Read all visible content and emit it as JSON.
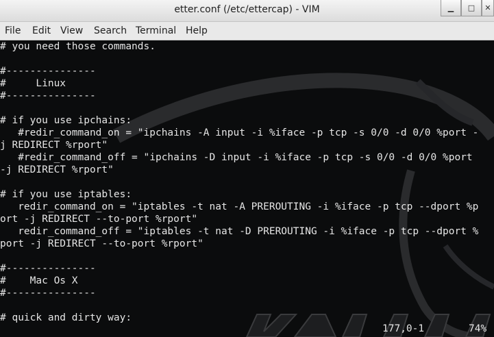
{
  "window": {
    "title": "etter.conf (/etc/ettercap) - VIM",
    "controls": [
      {
        "name": "minimize",
        "symbol": "▁"
      },
      {
        "name": "maximize",
        "symbol": "□"
      },
      {
        "name": "close",
        "symbol": "✕"
      }
    ]
  },
  "menu": [
    "File",
    "Edit",
    "View",
    "Search",
    "Terminal",
    "Help"
  ],
  "editor": {
    "lines": [
      "# you need those commands.",
      "",
      "#---------------",
      "#     Linux",
      "#---------------",
      "",
      "# if you use ipchains:",
      "   #redir_command_on = \"ipchains -A input -i %iface -p tcp -s 0/0 -d 0/0 %port -",
      "j REDIRECT %rport\"",
      "   #redir_command_off = \"ipchains -D input -i %iface -p tcp -s 0/0 -d 0/0 %port",
      "-j REDIRECT %rport\"",
      "",
      "# if you use iptables:",
      "   redir_command_on = \"iptables -t nat -A PREROUTING -i %iface -p tcp --dport %p",
      "ort -j REDIRECT --to-port %rport\"",
      "   redir_command_off = \"iptables -t nat -D PREROUTING -i %iface -p tcp --dport %",
      "port -j REDIRECT --to-port %rport\"",
      "",
      "#---------------",
      "#    Mac Os X",
      "#---------------",
      "",
      "# quick and dirty way:"
    ],
    "cursor_position": "177,0-1",
    "scroll_percent": "74%"
  },
  "colors": {
    "terminal_bg": "#0b0c0d",
    "text": "#e6e6e6",
    "menubar_bg": "#e9e9e9",
    "titlebar_bg": "#e8e8e8"
  }
}
